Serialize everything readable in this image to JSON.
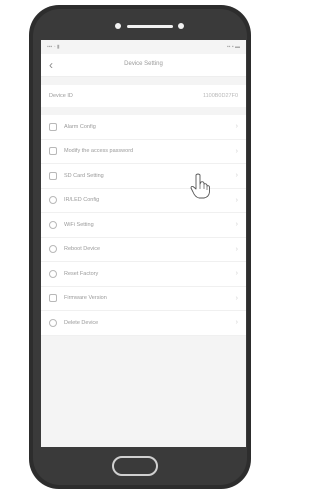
{
  "nav": {
    "title": "Device Setting",
    "back_icon": "chevron-left-icon"
  },
  "device": {
    "label": "Device ID",
    "value": "1100B0D27F0"
  },
  "menu": [
    {
      "label": "Alarm Config",
      "icon": "bell-icon"
    },
    {
      "label": "Modify the access password",
      "icon": "lock-icon"
    },
    {
      "label": "SD Card Setting",
      "icon": "sd-card-icon"
    },
    {
      "label": "IR/LED Config",
      "icon": "led-icon"
    },
    {
      "label": "WiFi Setting",
      "icon": "wifi-icon"
    },
    {
      "label": "Reboot Device",
      "icon": "reboot-icon"
    },
    {
      "label": "Reset Factory",
      "icon": "reset-icon"
    },
    {
      "label": "Firmware Version",
      "icon": "info-icon"
    },
    {
      "label": "Delete Device",
      "icon": "trash-icon"
    }
  ],
  "cursor_icon": "hand-pointer-icon"
}
